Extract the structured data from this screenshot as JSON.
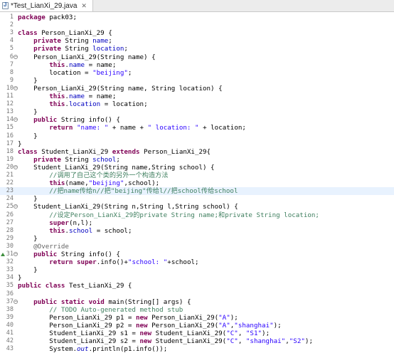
{
  "tab": {
    "title": "*Test_LianXi_29.java",
    "close": "✕"
  },
  "editor": {
    "current_line": 23,
    "lines": [
      {
        "n": "1",
        "t": "package pack03;"
      },
      {
        "n": "2",
        "t": ""
      },
      {
        "n": "3",
        "t": "class Person_LianXi_29 {"
      },
      {
        "n": "4",
        "t": "    private String name;"
      },
      {
        "n": "5",
        "t": "    private String location;"
      },
      {
        "n": "6",
        "t": "    Person_LianXi_29(String name) {"
      },
      {
        "n": "7",
        "t": "        this.name = name;"
      },
      {
        "n": "8",
        "t": "        location = \"beijing\";"
      },
      {
        "n": "9",
        "t": "    }"
      },
      {
        "n": "10",
        "t": "    Person_LianXi_29(String name, String location) {"
      },
      {
        "n": "11",
        "t": "        this.name = name;"
      },
      {
        "n": "12",
        "t": "        this.location = location;"
      },
      {
        "n": "13",
        "t": "    }"
      },
      {
        "n": "14",
        "t": "    public String info() {"
      },
      {
        "n": "15",
        "t": "        return \"name: \" + name + \" location: \" + location;"
      },
      {
        "n": "16",
        "t": "    }"
      },
      {
        "n": "17",
        "t": "}"
      },
      {
        "n": "18",
        "t": "class Student_LianXi_29 extends Person_LianXi_29{"
      },
      {
        "n": "19",
        "t": "    private String school;"
      },
      {
        "n": "20",
        "t": "    Student_LianXi_29(String name,String school) {"
      },
      {
        "n": "21",
        "t": "        //调用了自己这个类的另外一个构造方法"
      },
      {
        "n": "22",
        "t": "        this(name,\"beijing\",school);"
      },
      {
        "n": "23",
        "t": "        //把name传给n//把\"beijing\"传给l//把school传给school"
      },
      {
        "n": "24",
        "t": "    }"
      },
      {
        "n": "25",
        "t": "    Student_LianXi_29(String n,String l,String school) {"
      },
      {
        "n": "26",
        "t": "        //设定Person_LianXi_29的private String name;和private String location;"
      },
      {
        "n": "27",
        "t": "        super(n,l);"
      },
      {
        "n": "28",
        "t": "        this.school = school;"
      },
      {
        "n": "29",
        "t": "    }"
      },
      {
        "n": "30",
        "t": "    @Override"
      },
      {
        "n": "31",
        "t": "    public String info() {"
      },
      {
        "n": "32",
        "t": "        return super.info()+\"school: \"+school;"
      },
      {
        "n": "33",
        "t": "    }"
      },
      {
        "n": "34",
        "t": "}"
      },
      {
        "n": "35",
        "t": "public class Test_LianXi_29 {"
      },
      {
        "n": "36",
        "t": ""
      },
      {
        "n": "37",
        "t": "    public static void main(String[] args) {"
      },
      {
        "n": "38",
        "t": "        // TODO Auto-generated method stub"
      },
      {
        "n": "39",
        "t": "        Person_LianXi_29 p1 = new Person_LianXi_29(\"A\");"
      },
      {
        "n": "40",
        "t": "        Person_LianXi_29 p2 = new Person_LianXi_29(\"A\",\"shanghai\");"
      },
      {
        "n": "41",
        "t": "        Student_LianXi_29 s1 = new Student_LianXi_29(\"C\", \"S1\");"
      },
      {
        "n": "42",
        "t": "        Student_LianXi_29 s2 = new Student_LianXi_29(\"C\", \"shanghai\",\"S2\");"
      },
      {
        "n": "43",
        "t": "        System.out.println(p1.info());"
      }
    ]
  }
}
